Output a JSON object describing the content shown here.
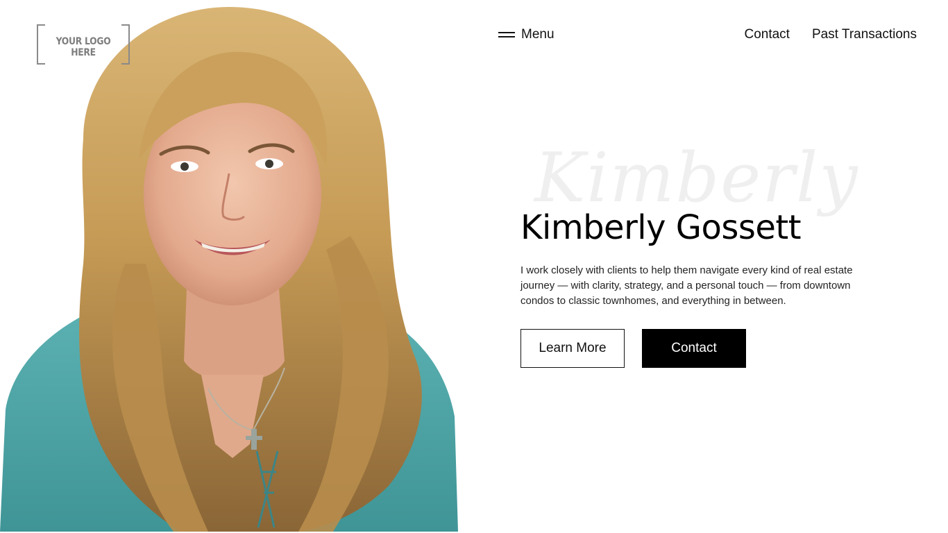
{
  "logo": {
    "text": "YOUR LOGO HERE"
  },
  "nav": {
    "menu_label": "Menu",
    "links": [
      {
        "label": "Contact"
      },
      {
        "label": "Past Transactions"
      }
    ]
  },
  "hero": {
    "script_text": "Kimberly",
    "name": "Kimberly Gossett",
    "description": "I work closely with clients to help them navigate every kind of real estate journey — with clarity, strategy, and a personal touch — from downtown condos to classic townhomes, and everything in between.",
    "buttons": {
      "primary": "Learn More",
      "secondary": "Contact"
    }
  },
  "colors": {
    "background": "#ffffff",
    "text": "#111111",
    "button_solid": "#000000",
    "blouse": "#4fa3a6",
    "hair": "#c49a55"
  },
  "icons": {
    "menu": "hamburger-icon"
  }
}
